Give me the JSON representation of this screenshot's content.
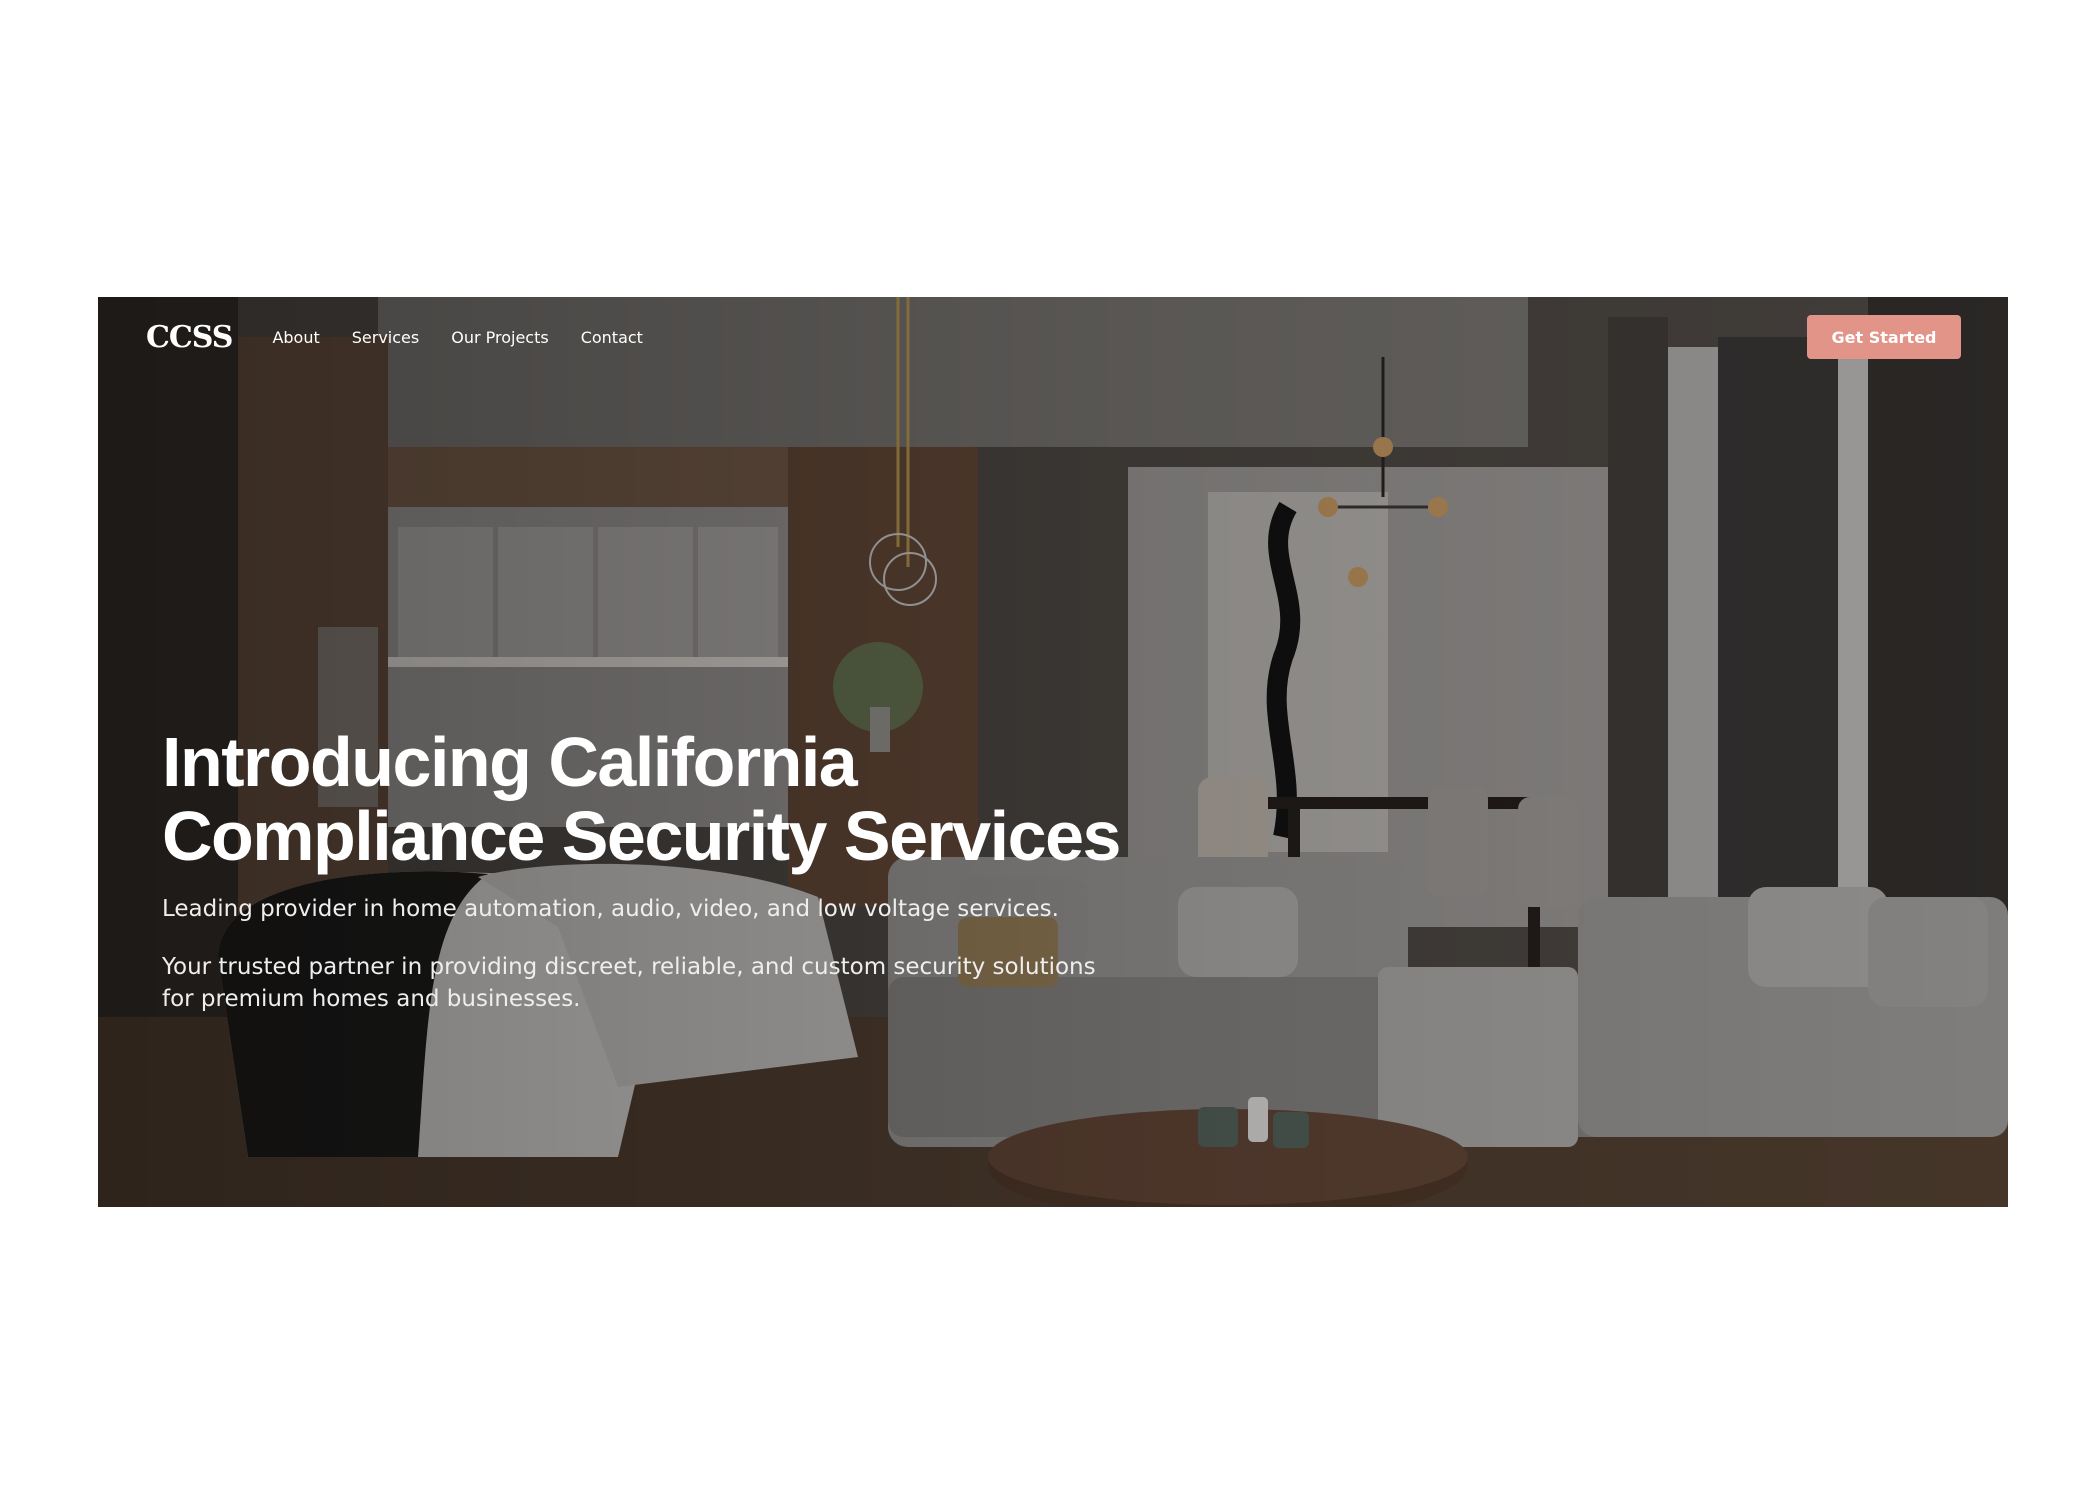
{
  "brand": {
    "logo_text": "CCSS"
  },
  "nav": {
    "items": [
      {
        "label": "About"
      },
      {
        "label": "Services"
      },
      {
        "label": "Our Projects"
      },
      {
        "label": "Contact"
      }
    ],
    "cta_label": "Get Started"
  },
  "hero": {
    "headline_line1": "Introducing California",
    "headline_line2": "Compliance Security Services",
    "subheading": "Leading provider in home automation, audio, video, and low voltage services.",
    "description": "Your trusted partner in providing discreet, reliable, and custom security solutions for premium homes and businesses."
  },
  "colors": {
    "cta_background": "#e19487",
    "text": "#ffffff"
  }
}
